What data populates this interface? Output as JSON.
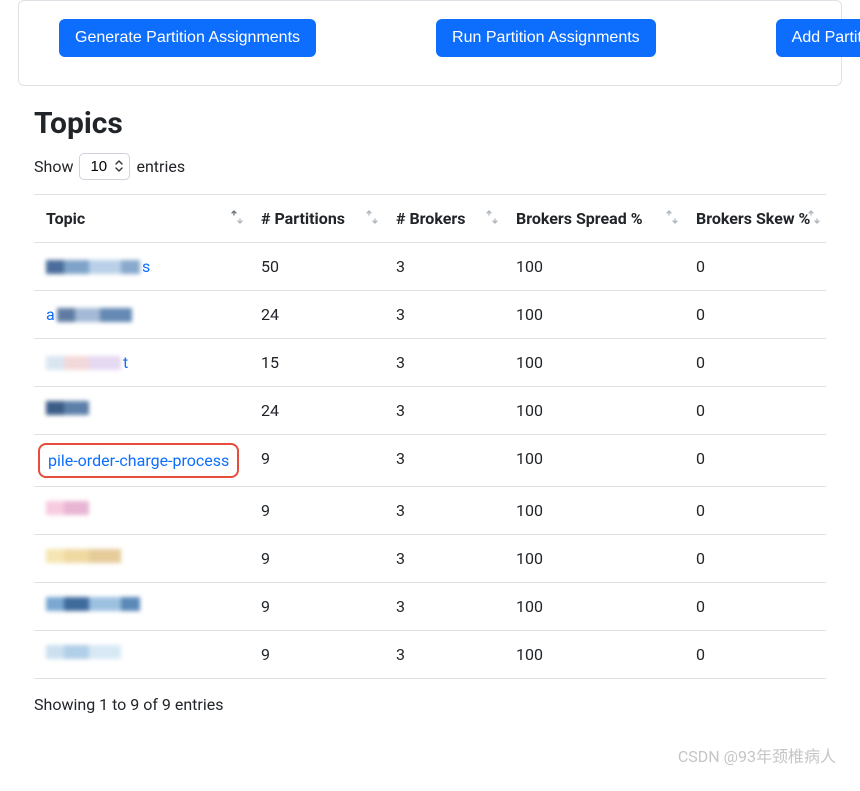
{
  "buttons": {
    "generate": "Generate Partition Assignments",
    "run": "Run Partition Assignments",
    "add": "Add Partitions"
  },
  "section": {
    "title": "Topics"
  },
  "entries": {
    "show_label": "Show",
    "entries_label": "entries",
    "selected": "10"
  },
  "columns": {
    "topic": "Topic",
    "partitions": "# Partitions",
    "brokers": "# Brokers",
    "spread": "Brokers Spread %",
    "skew": "Brokers Skew %"
  },
  "rows": [
    {
      "topic_redacted": true,
      "topic_suffix": "s",
      "partitions": "50",
      "brokers": "3",
      "spread": "100",
      "skew": "0"
    },
    {
      "topic_redacted": true,
      "topic_prefix": "a",
      "partitions": "24",
      "brokers": "3",
      "spread": "100",
      "skew": "0"
    },
    {
      "topic_redacted": true,
      "topic_suffix": "t",
      "partitions": "15",
      "brokers": "3",
      "spread": "100",
      "skew": "0"
    },
    {
      "topic_redacted": true,
      "partitions": "24",
      "brokers": "3",
      "spread": "100",
      "skew": "0"
    },
    {
      "topic": "pile-order-charge-process",
      "highlighted": true,
      "partitions": "9",
      "brokers": "3",
      "spread": "100",
      "skew": "0"
    },
    {
      "topic_redacted": true,
      "partitions": "9",
      "brokers": "3",
      "spread": "100",
      "skew": "0"
    },
    {
      "topic_redacted": true,
      "partitions": "9",
      "brokers": "3",
      "spread": "100",
      "skew": "0"
    },
    {
      "topic_redacted": true,
      "partitions": "9",
      "brokers": "3",
      "spread": "100",
      "skew": "0"
    },
    {
      "topic_redacted": true,
      "partitions": "9",
      "brokers": "3",
      "spread": "100",
      "skew": "0"
    }
  ],
  "footer": {
    "showing": "Showing 1 to 9 of 9 entries"
  },
  "watermark": "CSDN @93年颈椎病人"
}
